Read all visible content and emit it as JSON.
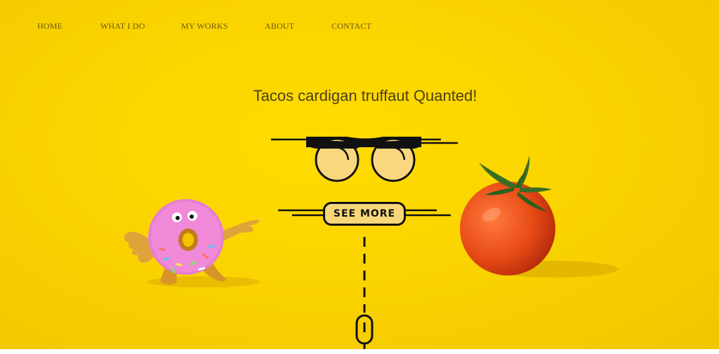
{
  "nav": {
    "items": [
      {
        "label": "HOME"
      },
      {
        "label": "WHAT I DO"
      },
      {
        "label": "MY WORKS"
      },
      {
        "label": "ABOUT"
      },
      {
        "label": "CONTACT"
      }
    ]
  },
  "hero": {
    "tagline": "Tacos cardigan truffaut Quanted!",
    "button_label": "SEE MORE",
    "background_color": "#fad400"
  },
  "icons": {
    "glasses": "glasses-icon",
    "scroll": "scroll-mouse-icon"
  }
}
